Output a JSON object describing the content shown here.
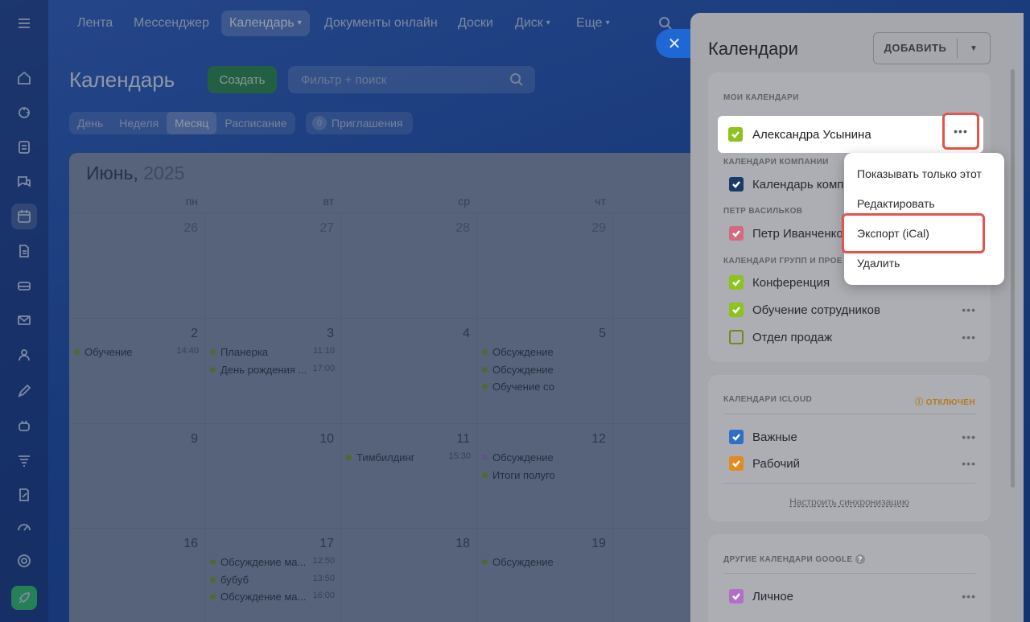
{
  "nav": {
    "items": [
      "Лента",
      "Мессенджер",
      "Календарь",
      "Документы онлайн",
      "Доски",
      "Диск",
      "Еще"
    ],
    "active": "Календарь"
  },
  "page": {
    "title": "Календарь",
    "create_label": "Создать",
    "filter_placeholder": "Фильтр + поиск",
    "view_tabs": [
      "День",
      "Неделя",
      "Месяц",
      "Расписание"
    ],
    "active_view": "Месяц",
    "invites_count": "0",
    "invites_label": "Приглашения"
  },
  "calendar": {
    "month": "Июнь,",
    "year": "2025",
    "day_headers": [
      "пн",
      "вт",
      "ср",
      "чт"
    ],
    "weeks": [
      {
        "days": [
          "26",
          "27",
          "28",
          "29"
        ],
        "events": []
      },
      {
        "days": [
          "2",
          "3",
          "4",
          "5"
        ],
        "events": [
          {
            "day": 0,
            "title": "Обучение",
            "time": "14:40"
          },
          {
            "day": 1,
            "title": "Планерка",
            "time": "11:10"
          },
          {
            "day": 1,
            "title": "День рождения ...",
            "time": "17:00"
          },
          {
            "day": 3,
            "title": "Обсуждение",
            "time": ""
          },
          {
            "day": 3,
            "title": "Обсуждение",
            "time": ""
          },
          {
            "day": 3,
            "title": "Обучение со",
            "time": ""
          }
        ]
      },
      {
        "days": [
          "9",
          "10",
          "11",
          "12"
        ],
        "events": [
          {
            "day": 2,
            "title": "Тимбилдинг",
            "time": "15:30"
          },
          {
            "day": 3,
            "title": "Обсуждение",
            "time": ""
          },
          {
            "day": 3,
            "title": "Итоги полуго",
            "time": ""
          }
        ]
      },
      {
        "days": [
          "16",
          "17",
          "18",
          "19"
        ],
        "events": [
          {
            "day": 1,
            "title": "Обсуждение ма...",
            "time": "12:50"
          },
          {
            "day": 1,
            "title": "бубуб",
            "time": "13:50"
          },
          {
            "day": 1,
            "title": "Обсуждение ма...",
            "time": "16:00"
          },
          {
            "day": 3,
            "title": "Обсуждение",
            "time": ""
          }
        ]
      }
    ]
  },
  "panel": {
    "title": "Календари",
    "add_label": "ДОБАВИТЬ",
    "sections": {
      "my": "МОИ КАЛЕНДАРИ",
      "company": "КАЛЕНДАРИ КОМПАНИИ",
      "user": "ПЕТР ВАСИЛЬКОВ",
      "groups": "КАЛЕНДАРИ ГРУПП И ПРОЕ",
      "icloud": "КАЛЕНДАРИ ICLOUD",
      "icloud_status": "ОТКЛЮЧЕН",
      "google": "ДРУГИЕ КАЛЕНДАРИ GOOGLE"
    },
    "my_calendar": "Александра Усынина",
    "company_calendar": "Календарь комп",
    "user_calendar": "Петр Иванченко",
    "groups": [
      "Конференция",
      "Обучение сотрудников",
      "Отдел продаж"
    ],
    "icloud": [
      "Важные",
      "Рабочий"
    ],
    "sync_link": "Настроить синхронизацию",
    "google": [
      "Личное"
    ],
    "colors": {
      "green": "#8dc21f",
      "navy": "#1b3a6b",
      "pink": "#d36a80",
      "blue": "#2f6fc9",
      "orange": "#e38a20",
      "violet": "#b36fc7",
      "alert": "#e5534b"
    }
  },
  "menu": {
    "items": [
      "Показывать только этот",
      "Редактировать",
      "Экспорт (iCal)",
      "Удалить"
    ]
  }
}
